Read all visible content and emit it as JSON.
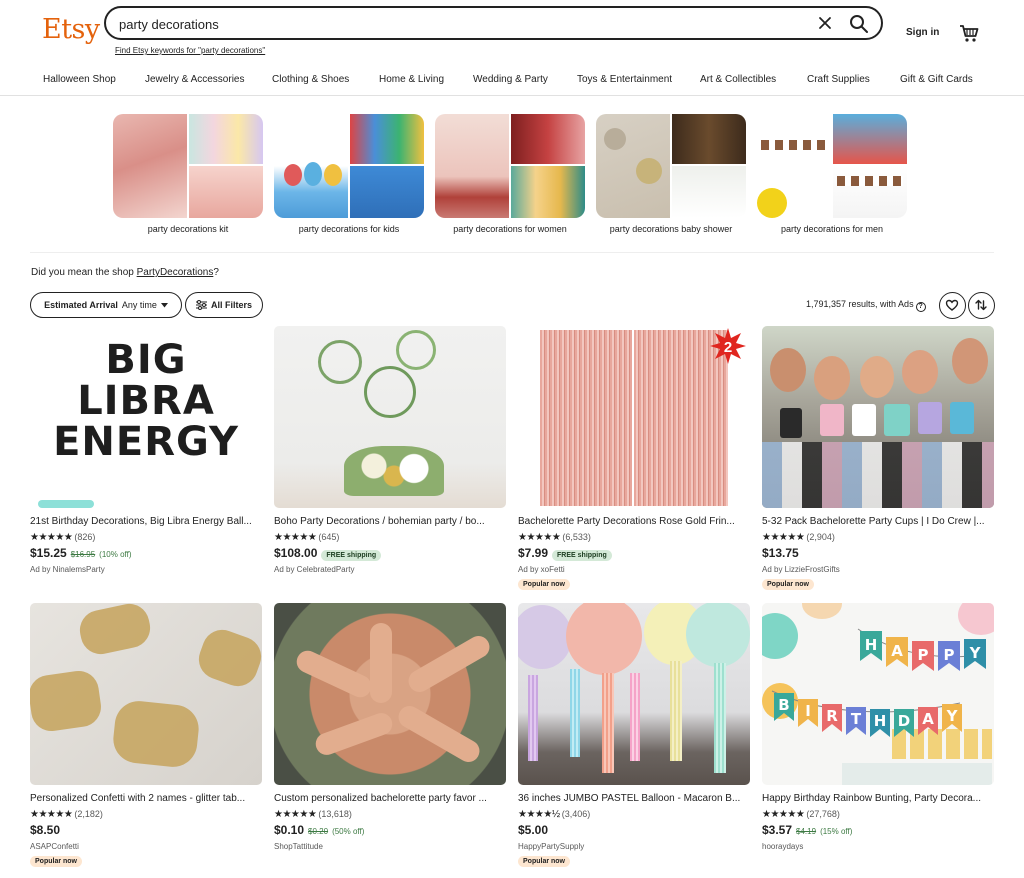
{
  "header": {
    "logo": "Etsy",
    "search_value": "party decorations",
    "keyword_link": "Find Etsy keywords for \"party decorations\"",
    "signin": "Sign in"
  },
  "categories": [
    "Halloween Shop",
    "Jewelry & Accessories",
    "Clothing & Shoes",
    "Home & Living",
    "Wedding & Party",
    "Toys & Entertainment",
    "Art & Collectibles",
    "Craft Supplies",
    "Gift & Gift Cards"
  ],
  "related_searches": [
    "party decorations kit",
    "party decorations for kids",
    "party decorations for women",
    "party decorations baby shower",
    "party decorations for men"
  ],
  "did_you_mean": {
    "prefix": "Did you mean the shop ",
    "shop": "PartyDecorations",
    "suffix": "?"
  },
  "filters": {
    "arrival_bold": "Estimated Arrival",
    "arrival_value": "Any time",
    "all_filters": "All Filters",
    "results": "1,791,357 results, with Ads"
  },
  "products": [
    {
      "title": "21st Birthday Decorations, Big Libra Energy Ball...",
      "stars": "★★★★★",
      "count": "(826)",
      "price": "$15.25",
      "orig": "$16.95",
      "discount": "(10% off)",
      "shipping": "",
      "seller": "Ad by NinalemsParty",
      "badge": ""
    },
    {
      "title": "Boho Party Decorations / bohemian party / bo...",
      "stars": "★★★★★",
      "count": "(645)",
      "price": "$108.00",
      "orig": "",
      "discount": "",
      "shipping": "FREE shipping",
      "seller": "Ad by CelebratedParty",
      "badge": ""
    },
    {
      "title": "Bachelorette Party Decorations Rose Gold Frin...",
      "stars": "★★★★★",
      "count": "(6,533)",
      "price": "$7.99",
      "orig": "",
      "discount": "",
      "shipping": "FREE shipping",
      "seller": "Ad by xoFetti",
      "badge": "Popular now"
    },
    {
      "title": "5-32 Pack Bachelorette Party Cups | I Do Crew |...",
      "stars": "★★★★★",
      "count": "(2,904)",
      "price": "$13.75",
      "orig": "",
      "discount": "",
      "shipping": "",
      "seller": "Ad by LizzieFrostGifts",
      "badge": "Popular now"
    },
    {
      "title": "Personalized Confetti with 2 names - glitter tab...",
      "stars": "★★★★★",
      "count": "(2,182)",
      "price": "$8.50",
      "orig": "",
      "discount": "",
      "shipping": "",
      "seller": "ASAPConfetti",
      "badge": "Popular now"
    },
    {
      "title": "Custom personalized bachelorette party favor ...",
      "stars": "★★★★★",
      "count": "(13,618)",
      "price": "$0.10",
      "orig": "$0.20",
      "discount": "(50% off)",
      "shipping": "",
      "seller": "ShopTattitude",
      "badge": ""
    },
    {
      "title": "36 inches JUMBO PASTEL Balloon - Macaron B...",
      "stars": "★★★★½",
      "count": "(3,406)",
      "price": "$5.00",
      "orig": "",
      "discount": "",
      "shipping": "",
      "seller": "HappyPartySupply",
      "badge": "Popular now"
    },
    {
      "title": "Happy Birthday Rainbow Bunting, Party Decora...",
      "stars": "★★★★★",
      "count": "(27,768)",
      "price": "$3.57",
      "orig": "$4.19",
      "discount": "(15% off)",
      "shipping": "",
      "seller": "hooraydays",
      "badge": ""
    }
  ],
  "image_text": {
    "balloon_letters": [
      "BIG",
      "LIBRA",
      "ENERGY"
    ],
    "badge_number": "2",
    "bunting_letters": [
      "H",
      "A",
      "P",
      "P",
      "Y",
      "B",
      "I",
      "R",
      "T",
      "H",
      "D",
      "A",
      "Y"
    ]
  },
  "colors": {
    "brand": "#e4620c",
    "sale_green": "#3d7a43",
    "shipping_bg": "#d4e9d7",
    "popular_bg": "#fde6d0"
  }
}
